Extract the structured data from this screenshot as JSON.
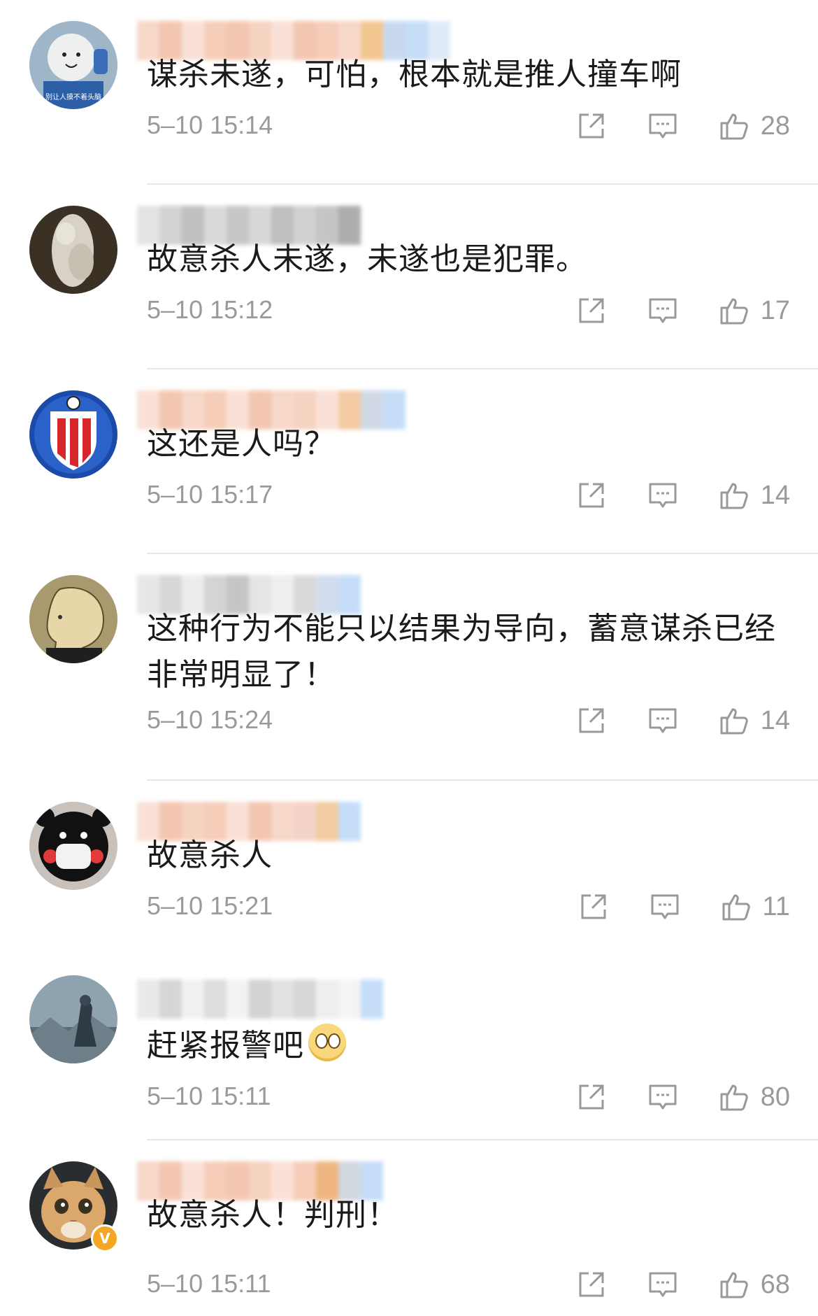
{
  "comments": [
    {
      "text": "谋杀未遂，可怕，根本就是推人撞车啊",
      "time": "5–10 15:14",
      "likes": "28",
      "has_emoji": false
    },
    {
      "text": "故意杀人未遂，未遂也是犯罪。",
      "time": "5–10 15:12",
      "likes": "17",
      "has_emoji": false
    },
    {
      "text": "这还是人吗？",
      "time": "5–10 15:17",
      "likes": "14",
      "has_emoji": false
    },
    {
      "text": "这种行为不能只以结果为导向，蓄意谋杀已经非常明显了！",
      "time": "5–10 15:24",
      "likes": "14",
      "has_emoji": false
    },
    {
      "text": "故意杀人",
      "time": "5–10 15:21",
      "likes": "11",
      "has_emoji": false
    },
    {
      "text": "赶紧报警吧",
      "time": "5–10 15:11",
      "likes": "80",
      "has_emoji": true
    },
    {
      "text": "故意杀人！判刑！",
      "time": "5–10 15:11",
      "likes": "68",
      "has_emoji": false,
      "verified": true
    }
  ],
  "avatar_text": {
    "c1": "别让人摸不着头脑"
  },
  "colors": {
    "text": "#1a1a1a",
    "meta": "#9a9a9a",
    "divider": "#e6e6e6",
    "verified_badge": "#f5a623",
    "badge_label": "V"
  },
  "icons": {
    "share": "share-icon",
    "reply": "comment-icon",
    "like": "thumbs-up-icon"
  }
}
